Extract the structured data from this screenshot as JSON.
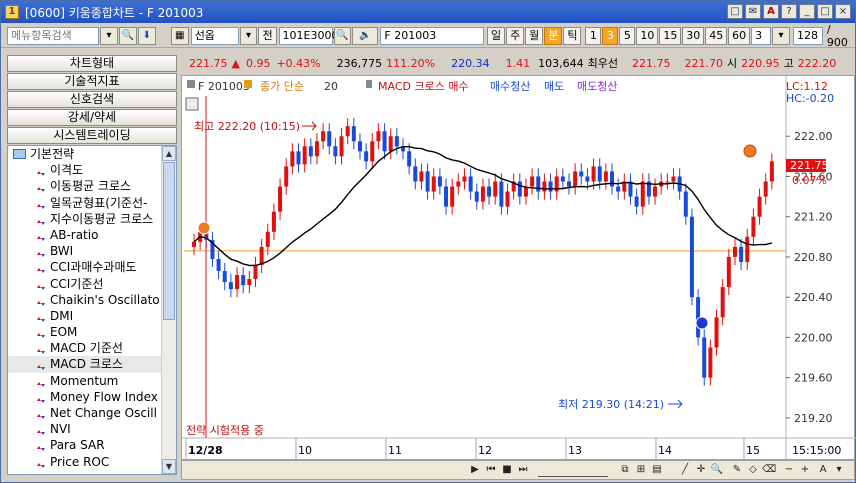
{
  "window": {
    "title": "[0600] 키움종합차트 - F 201003",
    "app_icon": "1",
    "title_buttons": [
      "□",
      "✉",
      "A",
      "?",
      "_",
      "□",
      "×"
    ]
  },
  "toolbar": {
    "menu_search_placeholder": "메뉴항목검색",
    "product_type": "선옵",
    "product_jeon": "전",
    "code": "101E3000",
    "code_name": "F 201003",
    "periods": [
      "일",
      "주",
      "월",
      "분",
      "틱"
    ],
    "active_period": "분",
    "intervals": [
      "1",
      "3",
      "5",
      "10",
      "15",
      "30",
      "45",
      "60"
    ],
    "active_interval": "3",
    "interval_input": "3",
    "count": "128",
    "count_total": "/ 900"
  },
  "left_menu": {
    "buttons": [
      "차트형태",
      "기술적지표",
      "신호검색",
      "강세/약세",
      "시스템트레이딩"
    ],
    "tree_root": "기본전략",
    "items": [
      "이격도",
      "이동평균 크로스",
      "일목균형표(기준선-",
      "지수이동평균 크로스",
      "AB-ratio",
      "BWI",
      "CCI과매수과매도",
      "CCI기준선",
      "Chaikin's Oscillato",
      "DMI",
      "EOM",
      "MACD 기준선",
      "MACD 크로스",
      "Momentum",
      "Money Flow Index",
      "Net Change Oscill",
      "NVI",
      "Para SAR",
      "Price ROC"
    ],
    "selected": "MACD 크로스"
  },
  "quote": {
    "price": "221.75",
    "arrow": "▲",
    "change": "0.95",
    "pct": "+0.43%",
    "volume": "236,775",
    "ratio": "111.20%",
    "v1": "220.34",
    "v2": "1.41",
    "v3": "103,644",
    "pri_label": "최우선",
    "ask": "221.75",
    "bid": "221.70",
    "open_label": "시",
    "open": "220.95",
    "high_label": "고",
    "high": "222.20"
  },
  "chart": {
    "legend_code": "F 201003",
    "legend_price": "종가 단순",
    "legend_period": "20",
    "legend_strategy": "MACD 크로스 매수",
    "legend_items": [
      "매수청산",
      "매도",
      "매도청산"
    ],
    "lc_label": "LC:1.12",
    "hc_label": "HC:-0.20",
    "high_marker": "최고 222.20 (10:15)",
    "low_marker": "최저 219.30 (14:21)",
    "current_price": "221.75",
    "current_pct": "0.07%",
    "strategy_status": "전략 시험적용 중",
    "x_labels": [
      "12/28",
      "10",
      "11",
      "12",
      "13",
      "14",
      "15"
    ],
    "x_right": "15:15:00",
    "colors": {
      "up": "#e01010",
      "down": "#1a4ad8",
      "ma": "#000000",
      "ref": "#f0a030"
    }
  },
  "chart_data": {
    "type": "candlestick",
    "y_ticks": [
      "222.00",
      "221.60",
      "221.20",
      "220.80",
      "220.40",
      "220.00",
      "219.60",
      "219.20"
    ],
    "ylim": [
      219.0,
      222.4
    ],
    "reference_line": 220.86,
    "closes": [
      220.95,
      221.05,
      220.97,
      220.78,
      220.66,
      220.55,
      220.48,
      220.62,
      220.52,
      220.58,
      220.72,
      220.9,
      221.05,
      221.25,
      221.5,
      221.7,
      221.85,
      221.72,
      221.9,
      221.8,
      221.95,
      222.05,
      221.9,
      221.8,
      222.0,
      222.1,
      221.95,
      221.85,
      221.75,
      221.95,
      222.05,
      221.85,
      222.0,
      221.9,
      221.85,
      221.7,
      221.55,
      221.65,
      221.45,
      221.6,
      221.5,
      221.3,
      221.5,
      221.55,
      221.6,
      221.45,
      221.35,
      221.5,
      221.4,
      221.55,
      221.3,
      221.45,
      221.55,
      221.4,
      221.5,
      221.6,
      221.45,
      221.55,
      221.45,
      221.6,
      221.55,
      221.5,
      221.65,
      221.6,
      221.55,
      221.7,
      221.55,
      221.65,
      221.5,
      221.45,
      221.55,
      221.4,
      221.3,
      221.55,
      221.4,
      221.5,
      221.55,
      221.55,
      221.6,
      221.45,
      221.2,
      220.4,
      220.0,
      219.6,
      219.9,
      220.2,
      220.5,
      220.8,
      220.9,
      220.75,
      221.0,
      221.2,
      221.4,
      221.55,
      221.75
    ],
    "ma_period": 20
  }
}
